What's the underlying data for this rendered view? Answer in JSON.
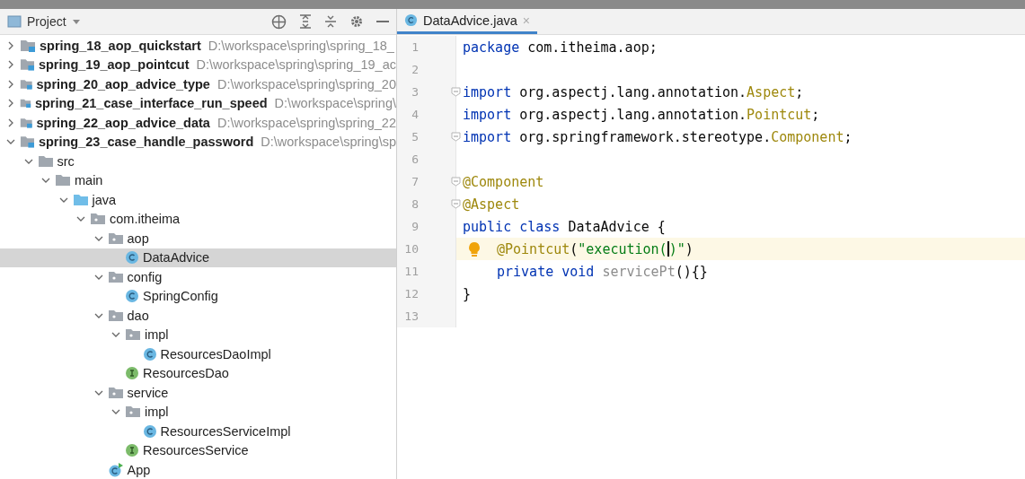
{
  "project_panel": {
    "title": "Project",
    "tree": [
      {
        "kind": "module",
        "name": "spring_18_aop_quickstart",
        "path": "D:\\workspace\\spring\\spring_18_",
        "expanded": false,
        "selected": false
      },
      {
        "kind": "module",
        "name": "spring_19_aop_pointcut",
        "path": "D:\\workspace\\spring\\spring_19_ac",
        "expanded": false,
        "selected": false
      },
      {
        "kind": "module",
        "name": "spring_20_aop_advice_type",
        "path": "D:\\workspace\\spring\\spring_20",
        "expanded": false,
        "selected": false
      },
      {
        "kind": "module",
        "name": "spring_21_case_interface_run_speed",
        "path": "D:\\workspace\\spring\\",
        "expanded": false,
        "selected": false
      },
      {
        "kind": "module",
        "name": "spring_22_aop_advice_data",
        "path": "D:\\workspace\\spring\\spring_22",
        "expanded": false,
        "selected": false
      },
      {
        "kind": "module",
        "name": "spring_23_case_handle_password",
        "path": "D:\\workspace\\spring\\sp",
        "expanded": true,
        "selected": false,
        "children": [
          {
            "kind": "folder",
            "name": "src",
            "expanded": true,
            "selected": false,
            "children": [
              {
                "kind": "folder",
                "name": "main",
                "expanded": true,
                "selected": false,
                "children": [
                  {
                    "kind": "source",
                    "name": "java",
                    "expanded": true,
                    "selected": false,
                    "children": [
                      {
                        "kind": "package",
                        "name": "com.itheima",
                        "expanded": true,
                        "selected": false,
                        "children": [
                          {
                            "kind": "package",
                            "name": "aop",
                            "expanded": true,
                            "selected": false,
                            "children": [
                              {
                                "kind": "class",
                                "name": "DataAdvice",
                                "selected": true
                              }
                            ]
                          },
                          {
                            "kind": "package",
                            "name": "config",
                            "expanded": true,
                            "selected": false,
                            "children": [
                              {
                                "kind": "class",
                                "name": "SpringConfig",
                                "selected": false
                              }
                            ]
                          },
                          {
                            "kind": "package",
                            "name": "dao",
                            "expanded": true,
                            "selected": false,
                            "children": [
                              {
                                "kind": "package",
                                "name": "impl",
                                "expanded": true,
                                "selected": false,
                                "children": [
                                  {
                                    "kind": "class",
                                    "name": "ResourcesDaoImpl",
                                    "selected": false
                                  }
                                ]
                              },
                              {
                                "kind": "interface",
                                "name": "ResourcesDao",
                                "selected": false
                              }
                            ]
                          },
                          {
                            "kind": "package",
                            "name": "service",
                            "expanded": true,
                            "selected": false,
                            "children": [
                              {
                                "kind": "package",
                                "name": "impl",
                                "expanded": true,
                                "selected": false,
                                "children": [
                                  {
                                    "kind": "class",
                                    "name": "ResourcesServiceImpl",
                                    "selected": false
                                  }
                                ]
                              },
                              {
                                "kind": "interface",
                                "name": "ResourcesService",
                                "selected": false
                              }
                            ]
                          },
                          {
                            "kind": "app",
                            "name": "App",
                            "selected": false
                          }
                        ]
                      }
                    ]
                  }
                ]
              }
            ]
          }
        ]
      }
    ]
  },
  "editor": {
    "tabs": [
      {
        "label": "DataAdvice.java",
        "close": "×",
        "selected": true
      }
    ],
    "lines": [
      {
        "number": "1",
        "current": false,
        "tokens": [
          {
            "kind": "kw",
            "text": "package"
          },
          {
            "kind": "plain",
            "text": " com.itheima.aop;"
          }
        ]
      },
      {
        "number": "2",
        "current": false
      },
      {
        "number": "3",
        "current": false,
        "fold": true,
        "tokens": [
          {
            "kind": "kw",
            "text": "import"
          },
          {
            "kind": "plain",
            "text": " org.aspectj.lang.annotation."
          },
          {
            "kind": "ann",
            "text": "Aspect"
          },
          {
            "kind": "plain",
            "text": ";"
          }
        ]
      },
      {
        "number": "4",
        "current": false,
        "tokens": [
          {
            "kind": "kw",
            "text": "import"
          },
          {
            "kind": "plain",
            "text": " org.aspectj.lang.annotation."
          },
          {
            "kind": "ann",
            "text": "Pointcut"
          },
          {
            "kind": "plain",
            "text": ";"
          }
        ]
      },
      {
        "number": "5",
        "current": false,
        "fold": true,
        "tokens": [
          {
            "kind": "kw",
            "text": "import"
          },
          {
            "kind": "plain",
            "text": " org.springframework.stereotype."
          },
          {
            "kind": "ann",
            "text": "Component"
          },
          {
            "kind": "plain",
            "text": ";"
          }
        ]
      },
      {
        "number": "6",
        "current": false
      },
      {
        "number": "7",
        "current": false,
        "fold": true,
        "tokens": [
          {
            "kind": "ann",
            "text": "@Component"
          }
        ]
      },
      {
        "number": "8",
        "current": false,
        "fold": true,
        "tokens": [
          {
            "kind": "ann",
            "text": "@Aspect"
          }
        ]
      },
      {
        "number": "9",
        "current": false,
        "tokens": [
          {
            "kind": "kw",
            "text": "public class"
          },
          {
            "kind": "plain",
            "text": " DataAdvice {"
          }
        ]
      },
      {
        "number": "10",
        "current": true,
        "indent": true,
        "bulb": true,
        "tokens": [
          {
            "kind": "ann",
            "text": "@Pointcut"
          },
          {
            "kind": "plain",
            "text": "("
          },
          {
            "kind": "str",
            "text": "\"execution(",
            "caret_after": true
          },
          {
            "kind": "str",
            "text": ")\""
          },
          {
            "kind": "plain",
            "text": ")"
          }
        ]
      },
      {
        "number": "11",
        "current": false,
        "indent": true,
        "tokens": [
          {
            "kind": "kw",
            "text": "private void"
          },
          {
            "kind": "unused",
            "text": " servicePt"
          },
          {
            "kind": "plain",
            "text": "(){}"
          }
        ]
      },
      {
        "number": "12",
        "current": false,
        "tokens": [
          {
            "kind": "plain",
            "text": "}"
          }
        ]
      },
      {
        "number": "13",
        "current": false
      }
    ]
  }
}
